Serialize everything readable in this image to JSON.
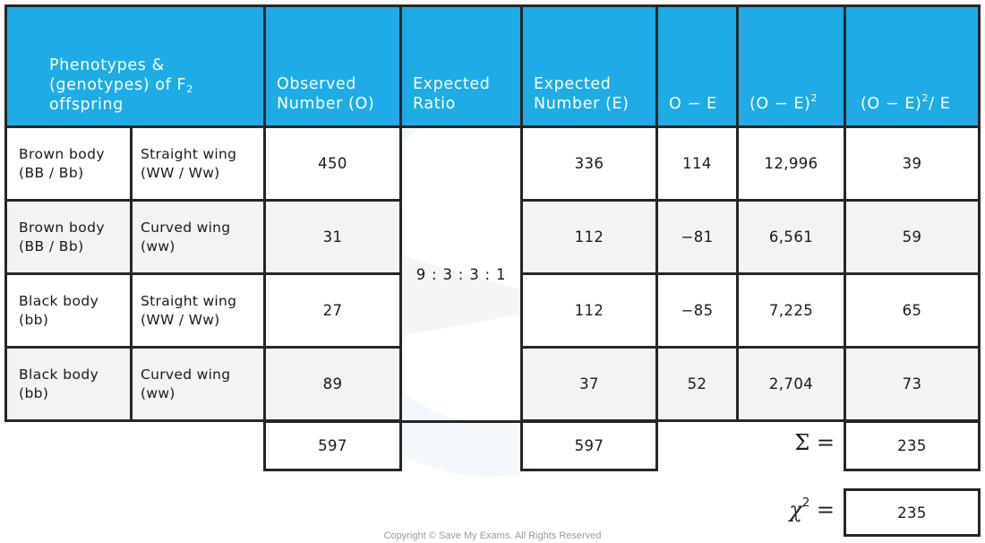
{
  "header": {
    "phenotypes_line1": "Phenotypes &",
    "phenotypes_line2": "(genotypes) of F",
    "phenotypes_sub": "2",
    "phenotypes_line3": "offspring",
    "observed_line1": "Observed",
    "observed_line2": "Number (O)",
    "ratio_line1": "Expected",
    "ratio_line2": "Ratio",
    "expected_line1": "Expected",
    "expected_line2": "Number (E)",
    "o_minus_e": "O − E",
    "o_minus_e_sq": "(O − E)",
    "o_minus_e_sq_sup": "2",
    "chi_term": "(O − E)",
    "chi_term_sup": "2",
    "chi_term_tail": "/ E"
  },
  "rows": [
    {
      "body_line1": "Brown body",
      "body_line2": "(BB / Bb)",
      "wing_line1": "Straight wing",
      "wing_line2": "(WW / Ww)",
      "observed": "450",
      "expected": "336",
      "o_minus_e": "114",
      "o_minus_e_sq": "12,996",
      "chi_term": "39"
    },
    {
      "body_line1": "Brown body",
      "body_line2": "(BB / Bb)",
      "wing_line1": "Curved wing",
      "wing_line2": "(ww)",
      "observed": "31",
      "expected": "112",
      "o_minus_e": "−81",
      "o_minus_e_sq": "6,561",
      "chi_term": "59"
    },
    {
      "body_line1": "Black body",
      "body_line2": "(bb)",
      "wing_line1": "Straight wing",
      "wing_line2": "(WW / Ww)",
      "observed": "27",
      "expected": "112",
      "o_minus_e": "−85",
      "o_minus_e_sq": "7,225",
      "chi_term": "65"
    },
    {
      "body_line1": "Black body",
      "body_line2": "(bb)",
      "wing_line1": "Curved wing",
      "wing_line2": "(ww)",
      "observed": "89",
      "expected": "37",
      "o_minus_e": "52",
      "o_minus_e_sq": "2,704",
      "chi_term": "73"
    }
  ],
  "expected_ratio": "9 : 3 : 3 : 1",
  "totals": {
    "observed": "597",
    "expected": "597",
    "sum_label": "Σ =",
    "sum_value": "235"
  },
  "chi_square": {
    "symbol": "χ",
    "sup": "2",
    "equals": "=",
    "value": "235"
  },
  "copyright": "Copyright © Save My Exams. All Rights Reserved",
  "colors": {
    "header_bg": "#1eabe6",
    "header_text": "#ffffff",
    "border": "#262626",
    "shaded_row": "#f3f3f3"
  }
}
